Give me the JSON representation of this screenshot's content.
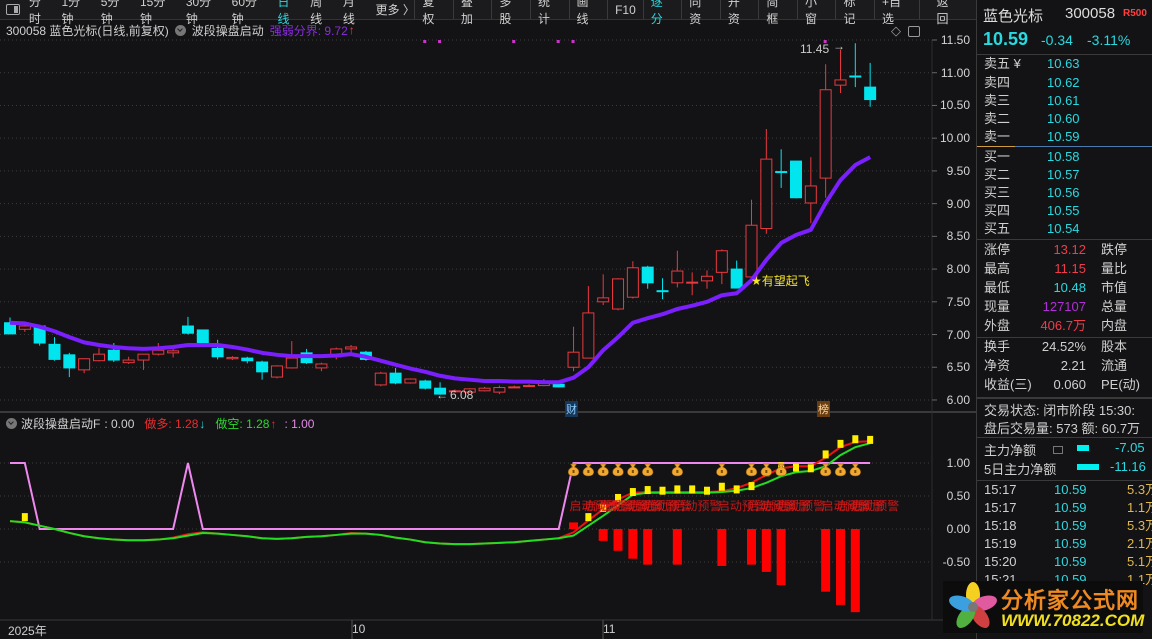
{
  "toolbar": {
    "periods": [
      "分时",
      "1分钟",
      "5分钟",
      "15分钟",
      "30分钟",
      "60分钟",
      "日线",
      "周线",
      "月线",
      "更多 〉"
    ],
    "active_period": "日线",
    "buttons": [
      "复权",
      "叠加",
      "多股",
      "统计",
      "画线",
      "F10",
      "逐分",
      "同资",
      "开资",
      "简框",
      "小窗",
      "标记",
      "+自选",
      "返回"
    ],
    "active_button": "逐分"
  },
  "info": {
    "title": "300058 蓝色光标(日线,前复权)",
    "indicator": "波段操盘启动",
    "threshold": "强弱分界: 9.72",
    "threshold_arrow": "↑"
  },
  "main_chart": {
    "price_ticks": [
      "11.50",
      "11.00",
      "10.50",
      "10.00",
      "9.50",
      "9.00",
      "8.50",
      "8.00",
      "7.50",
      "7.00",
      "6.50",
      "6.00"
    ],
    "high_label": "11.45",
    "low_label": "6.08",
    "signal_label": "★有望起飞",
    "tag_cai": "财",
    "tag_bang": "榜",
    "colors": {
      "up": "#e8393f",
      "down": "#00e5ee",
      "ma": "#7b1fff"
    }
  },
  "indicator": {
    "name": "波段操盘启动F",
    "f_value": ": 0.00",
    "long_label": "做多: 1.28",
    "long_arrow": "↓",
    "short_label": "做空: 1.28",
    "short_arrow": "↑",
    "third_value": ": 1.00",
    "ticks": [
      "1.00",
      "0.50",
      "0.00",
      "-0.50"
    ],
    "alert_text": "启动预警"
  },
  "time_axis": [
    "2025年",
    "10",
    "11"
  ],
  "chart_data": {
    "type": "candlestick",
    "price_range": [
      6.0,
      11.5
    ],
    "ohlc": [
      [
        7.18,
        7.26,
        7.0,
        7.01
      ],
      [
        7.08,
        7.15,
        7.04,
        7.13
      ],
      [
        7.13,
        7.15,
        6.83,
        6.87
      ],
      [
        6.85,
        6.96,
        6.6,
        6.62
      ],
      [
        6.69,
        6.72,
        6.35,
        6.49
      ],
      [
        6.46,
        6.63,
        6.41,
        6.63
      ],
      [
        6.6,
        6.79,
        6.59,
        6.7
      ],
      [
        6.76,
        6.87,
        6.58,
        6.61
      ],
      [
        6.57,
        6.66,
        6.55,
        6.61
      ],
      [
        6.61,
        6.7,
        6.46,
        6.7
      ],
      [
        6.7,
        6.87,
        6.68,
        6.76
      ],
      [
        6.72,
        6.81,
        6.65,
        6.75
      ],
      [
        7.13,
        7.27,
        7.0,
        7.02
      ],
      [
        7.07,
        7.07,
        6.87,
        6.87
      ],
      [
        6.79,
        6.92,
        6.62,
        6.66
      ],
      [
        6.63,
        6.67,
        6.61,
        6.65
      ],
      [
        6.64,
        6.66,
        6.56,
        6.6
      ],
      [
        6.58,
        6.6,
        6.31,
        6.43
      ],
      [
        6.35,
        6.53,
        6.33,
        6.52
      ],
      [
        6.49,
        6.9,
        6.48,
        6.64
      ],
      [
        6.72,
        6.78,
        6.55,
        6.57
      ],
      [
        6.49,
        6.57,
        6.44,
        6.55
      ],
      [
        6.66,
        6.8,
        6.62,
        6.78
      ],
      [
        6.78,
        6.84,
        6.7,
        6.81
      ],
      [
        6.73,
        6.75,
        6.6,
        6.62
      ],
      [
        6.23,
        6.43,
        6.21,
        6.41
      ],
      [
        6.41,
        6.49,
        6.24,
        6.26
      ],
      [
        6.26,
        6.33,
        6.25,
        6.32
      ],
      [
        6.29,
        6.31,
        6.16,
        6.18
      ],
      [
        6.18,
        6.27,
        6.08,
        6.09
      ],
      [
        6.14,
        6.16,
        6.12,
        6.14
      ],
      [
        6.12,
        6.18,
        6.11,
        6.17
      ],
      [
        6.14,
        6.2,
        6.13,
        6.18
      ],
      [
        6.12,
        6.22,
        6.09,
        6.19
      ],
      [
        6.2,
        6.22,
        6.19,
        6.2
      ],
      [
        6.22,
        6.24,
        6.2,
        6.22
      ],
      [
        6.22,
        6.32,
        6.21,
        6.28
      ],
      [
        6.24,
        6.26,
        6.19,
        6.2
      ],
      [
        6.5,
        7.12,
        6.44,
        6.73
      ],
      [
        6.64,
        7.74,
        6.64,
        7.33
      ],
      [
        7.5,
        7.92,
        7.45,
        7.56
      ],
      [
        7.39,
        7.86,
        7.37,
        7.85
      ],
      [
        7.57,
        8.12,
        7.55,
        8.02
      ],
      [
        8.03,
        8.05,
        7.7,
        7.79
      ],
      [
        7.67,
        7.86,
        7.54,
        7.66
      ],
      [
        7.79,
        8.28,
        7.72,
        7.97
      ],
      [
        7.79,
        7.95,
        7.6,
        7.8
      ],
      [
        7.82,
        7.98,
        7.7,
        7.89
      ],
      [
        7.95,
        8.3,
        7.77,
        8.28
      ],
      [
        8.0,
        8.13,
        7.71,
        7.71
      ],
      [
        7.88,
        9.06,
        7.86,
        8.67
      ],
      [
        8.62,
        10.14,
        8.54,
        9.68
      ],
      [
        9.49,
        9.83,
        9.24,
        9.48
      ],
      [
        9.65,
        9.65,
        9.08,
        9.09
      ],
      [
        9.01,
        9.71,
        8.7,
        9.27
      ],
      [
        9.39,
        11.13,
        9.09,
        10.74
      ],
      [
        10.81,
        11.35,
        10.69,
        10.89
      ],
      [
        10.95,
        11.45,
        10.78,
        10.94
      ],
      [
        10.78,
        11.15,
        10.48,
        10.59
      ]
    ],
    "ma": [
      7.18,
      7.17,
      7.12,
      7.05,
      6.96,
      6.88,
      6.84,
      6.81,
      6.79,
      6.78,
      6.79,
      6.81,
      6.84,
      6.84,
      6.84,
      6.81,
      6.77,
      6.72,
      6.69,
      6.67,
      6.67,
      6.67,
      6.68,
      6.7,
      6.66,
      6.6,
      6.54,
      6.48,
      6.43,
      6.37,
      6.33,
      6.31,
      6.29,
      6.29,
      6.28,
      6.28,
      6.27,
      6.27,
      6.34,
      6.5,
      6.76,
      6.96,
      7.18,
      7.25,
      7.31,
      7.39,
      7.44,
      7.5,
      7.6,
      7.63,
      7.83,
      8.14,
      8.4,
      8.52,
      8.6,
      9.01,
      9.36,
      9.59,
      9.71
    ],
    "top_markers": [
      28,
      29,
      34,
      37,
      38,
      55
    ],
    "indicator_range": [
      -1.5,
      1.5
    ],
    "green": [
      0.12,
      0.1,
      0.05,
      0.0,
      -0.06,
      -0.11,
      -0.14,
      -0.16,
      -0.17,
      -0.17,
      -0.16,
      -0.14,
      -0.1,
      -0.06,
      -0.07,
      -0.09,
      -0.11,
      -0.14,
      -0.15,
      -0.14,
      -0.12,
      -0.11,
      -0.09,
      -0.07,
      -0.07,
      -0.09,
      -0.13,
      -0.16,
      -0.2,
      -0.22,
      -0.23,
      -0.23,
      -0.22,
      -0.21,
      -0.2,
      -0.18,
      -0.16,
      -0.14,
      -0.1,
      0.05,
      0.2,
      0.36,
      0.52,
      0.55,
      0.55,
      0.55,
      0.55,
      0.55,
      0.56,
      0.58,
      0.62,
      0.7,
      0.8,
      0.86,
      0.88,
      0.95,
      1.12,
      1.24,
      1.3
    ],
    "red": [
      0.12,
      0.1,
      0.05,
      0.0,
      -0.06,
      -0.11,
      -0.14,
      -0.16,
      -0.17,
      -0.17,
      -0.16,
      -0.13,
      -0.08,
      -0.05,
      -0.07,
      -0.09,
      -0.11,
      -0.14,
      -0.15,
      -0.14,
      -0.12,
      -0.11,
      -0.09,
      -0.06,
      -0.07,
      -0.09,
      -0.13,
      -0.16,
      -0.2,
      -0.22,
      -0.23,
      -0.23,
      -0.22,
      -0.21,
      -0.2,
      -0.18,
      -0.16,
      -0.14,
      -0.05,
      0.13,
      0.3,
      0.45,
      0.55,
      0.56,
      0.56,
      0.56,
      0.56,
      0.56,
      0.57,
      0.62,
      0.7,
      0.82,
      0.92,
      0.95,
      0.95,
      1.08,
      1.24,
      1.32,
      1.33
    ],
    "pink": [
      1,
      1,
      0,
      0,
      0,
      0,
      0,
      0,
      0,
      0,
      0,
      0,
      1,
      0,
      0,
      0,
      0,
      0,
      0,
      0,
      0,
      0,
      0,
      0,
      0,
      0,
      0,
      0,
      0,
      0,
      0,
      0,
      0,
      0,
      0,
      0,
      0,
      0,
      1,
      1,
      1,
      1,
      1,
      1,
      1,
      1,
      1,
      1,
      1,
      1,
      1,
      1,
      1,
      1,
      1,
      1,
      1,
      1,
      1
    ],
    "yellow": {
      "1": 0.18,
      "39": 0.18,
      "40": 0.32,
      "41": 0.47,
      "42": 0.56,
      "43": 0.59,
      "44": 0.58,
      "45": 0.6,
      "46": 0.6,
      "47": 0.58,
      "48": 0.64,
      "49": 0.6,
      "50": 0.65,
      "51": 0.86,
      "52": 0.95,
      "53": 0.93,
      "54": 0.92,
      "55": 1.13,
      "56": 1.29,
      "57": 1.36,
      "58": 1.35
    },
    "bars": {
      "38": 0.1,
      "40": -0.18,
      "41": -0.33,
      "42": -0.45,
      "43": -0.54,
      "45": -0.54,
      "48": -0.56,
      "50": -0.54,
      "51": -0.65,
      "52": -0.85,
      "55": -0.95,
      "56": -1.15,
      "57": -1.26
    },
    "bags": [
      38,
      39,
      40,
      41,
      42,
      43,
      45,
      48,
      50,
      51,
      52,
      55,
      56,
      57
    ]
  },
  "quote": {
    "name": "蓝色光标",
    "code": "300058",
    "badge": "R500",
    "price": "10.59",
    "change": "-0.34",
    "pct": "-3.11%",
    "asks": [
      {
        "label": "卖五 ¥",
        "price": "10.63"
      },
      {
        "label": "卖四",
        "price": "10.62"
      },
      {
        "label": "卖三",
        "price": "10.61"
      },
      {
        "label": "卖二",
        "price": "10.60"
      },
      {
        "label": "卖一",
        "price": "10.59"
      }
    ],
    "bids": [
      {
        "label": "买一",
        "price": "10.58"
      },
      {
        "label": "买二",
        "price": "10.57"
      },
      {
        "label": "买三",
        "price": "10.56"
      },
      {
        "label": "买四",
        "price": "10.55"
      },
      {
        "label": "买五",
        "price": "10.54"
      }
    ],
    "stats": [
      {
        "label": "涨停",
        "value": "13.12",
        "label2": "跌停"
      },
      {
        "label": "最高",
        "value": "11.15",
        "label2": "量比"
      },
      {
        "label": "最低",
        "value": "10.48",
        "label2": "市值"
      },
      {
        "label": "现量",
        "value": "127107",
        "label2": "总量"
      },
      {
        "label": "外盘",
        "value": "406.7万",
        "label2": "内盘"
      }
    ],
    "stats2": [
      {
        "label": "换手",
        "value": "24.52%",
        "label2": "股本"
      },
      {
        "label": "净资",
        "value": "2.21",
        "label2": "流通"
      },
      {
        "label": "收益(三)",
        "value": "0.060",
        "label2": "PE(动)"
      }
    ],
    "trade_status": "交易状态: 闭市阶段 15:30:",
    "after_hours": "盘后交易量: 573  额: 60.7万",
    "main_net": {
      "label": "主力净额",
      "value": "-7.05"
    },
    "main_net5": {
      "label": "5日主力净额",
      "value": "-11.16"
    },
    "ticks": [
      {
        "time": "15:17",
        "price": "10.59",
        "vol": "5.3万"
      },
      {
        "time": "15:17",
        "price": "10.59",
        "vol": "1.1万"
      },
      {
        "time": "15:18",
        "price": "10.59",
        "vol": "5.3万"
      },
      {
        "time": "15:19",
        "price": "10.59",
        "vol": "2.1万"
      },
      {
        "time": "15:20",
        "price": "10.59",
        "vol": "5.1万"
      },
      {
        "time": "15:21",
        "price": "10.59",
        "vol": "1.1万"
      }
    ]
  },
  "watermark": {
    "title": "分析家公式网",
    "url": "WWW.70822.COM"
  }
}
